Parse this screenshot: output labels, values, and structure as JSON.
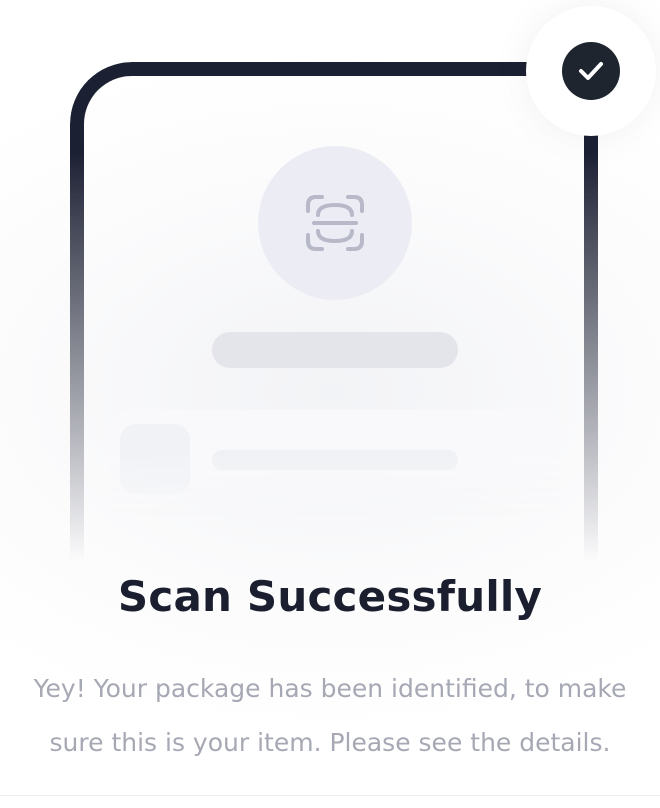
{
  "screen": {
    "title": "Scan Successfully",
    "subtitle_line1": "Yey! Your package has been identified, to make",
    "subtitle_line2": "sure this is your item. Please see the details."
  },
  "icons": {
    "badge": "check-icon",
    "scan": "barcode-scan-icon"
  },
  "colors": {
    "frame": "#1c2033",
    "badge": "#1e252e",
    "title": "#1a1e2e",
    "subtitle": "#a6a8b4"
  }
}
